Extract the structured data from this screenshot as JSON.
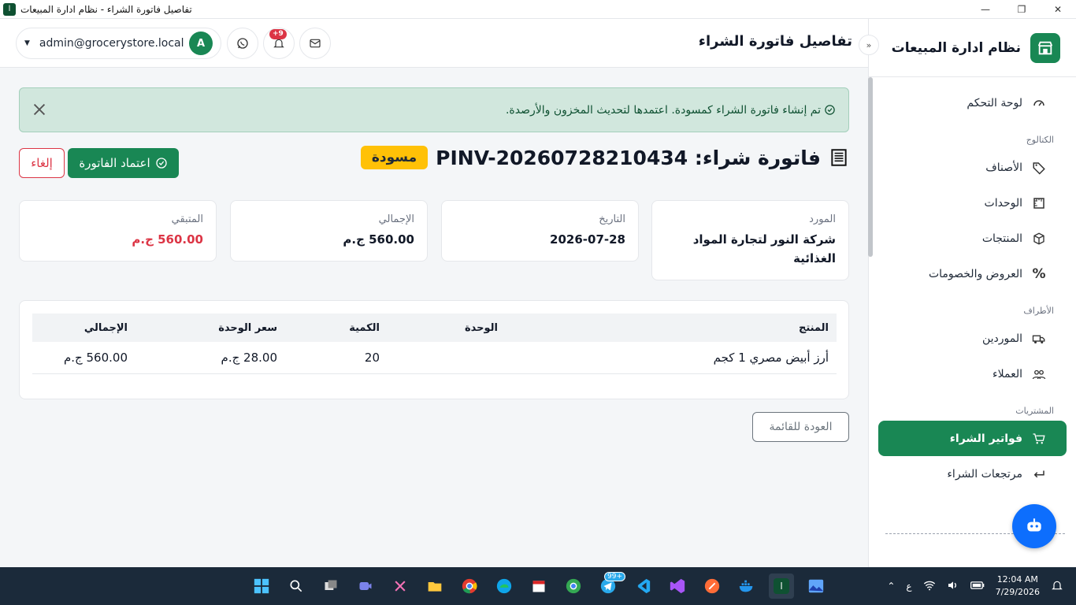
{
  "window": {
    "title": "تفاصيل فاتورة الشراء - نظام ادارة المبيعات"
  },
  "sidebar": {
    "brand": "نظام ادارة المبيعات",
    "items": [
      {
        "label": "لوحة التحكم",
        "icon": "dashboard-icon"
      },
      {
        "section": "الكتالوج"
      },
      {
        "label": "الأصناف",
        "icon": "tag-icon"
      },
      {
        "label": "الوحدات",
        "icon": "ruler-icon"
      },
      {
        "label": "المنتجات",
        "icon": "box-icon"
      },
      {
        "label": "العروض والخصومات",
        "icon": "percent-icon"
      },
      {
        "section": "الأطراف"
      },
      {
        "label": "الموردين",
        "icon": "truck-icon"
      },
      {
        "label": "العملاء",
        "icon": "users-icon"
      },
      {
        "section": "المشتريات"
      },
      {
        "label": "فواتير الشراء",
        "icon": "cart-icon",
        "active": true
      },
      {
        "label": "مرتجعات الشراء",
        "icon": "return-icon"
      }
    ]
  },
  "header": {
    "title": "تفاصيل فاتورة الشراء",
    "user_email": "admin@grocerystore.local",
    "avatar_letter": "A",
    "notif_count": "+9"
  },
  "alert": {
    "message": "تم إنشاء فاتورة الشراء كمسودة. اعتمدها لتحديث المخزون والأرصدة."
  },
  "invoice": {
    "title": "فاتورة شراء: PINV-20260728210434",
    "status": "مسودة",
    "approve_label": "اعتماد الفاتورة",
    "cancel_label": "إلغاء",
    "cards": [
      {
        "label": "المورد",
        "value": "شركة النور لتجارة المواد الغذائية"
      },
      {
        "label": "التاريخ",
        "value": "2026-07-28"
      },
      {
        "label": "الإجمالي",
        "value": "560.00 ج.م"
      },
      {
        "label": "المتبقي",
        "value": "560.00 ج.م"
      }
    ],
    "table": {
      "headers": [
        "المنتج",
        "الوحدة",
        "الكمية",
        "سعر الوحدة",
        "الإجمالي"
      ],
      "rows": [
        [
          "أرز أبيض مصري 1 كجم",
          "",
          "20",
          "28.00 ج.م",
          "560.00 ج.م"
        ]
      ]
    },
    "back_label": "العودة للقائمة"
  },
  "taskbar": {
    "lang": "ع",
    "time": "12:04 AM",
    "date": "7/29/2026",
    "telegram_badge": "99+"
  },
  "colors": {
    "primary": "#198754",
    "warning": "#ffc107",
    "danger": "#dc3545",
    "info": "#0d6efd"
  }
}
